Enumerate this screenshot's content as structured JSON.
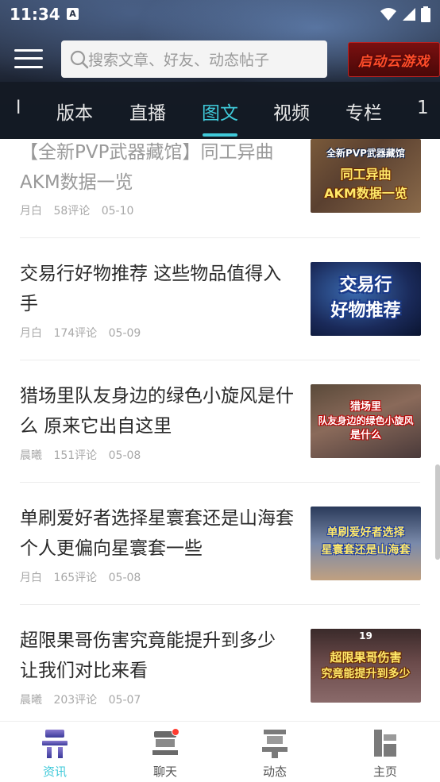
{
  "status_bar": {
    "time": "11:34",
    "a_icon": "A"
  },
  "header": {
    "search_placeholder": "搜索文章、好友、动态帖子",
    "cloud_game_button": "启动云游戏"
  },
  "tabs": [
    {
      "label": "l"
    },
    {
      "label": "版本"
    },
    {
      "label": "直播"
    },
    {
      "label": "图文",
      "active": true
    },
    {
      "label": "视频"
    },
    {
      "label": "专栏"
    },
    {
      "label": "1"
    }
  ],
  "articles": [
    {
      "title": "【全新PVP武器藏馆】同工异曲AKM数据一览",
      "author": "月白",
      "comments": "58评论",
      "date": "05-10",
      "thumb_lines": [
        "全新PVP武器藏馆",
        "同工异曲",
        "AKM数据一览"
      ]
    },
    {
      "title": "交易行好物推荐 这些物品值得入手",
      "author": "月白",
      "comments": "174评论",
      "date": "05-09",
      "thumb_lines": [
        "交易行",
        "好物推荐"
      ]
    },
    {
      "title": "猎场里队友身边的绿色小旋风是什么 原来它出自这里",
      "author": "晨曦",
      "comments": "151评论",
      "date": "05-08",
      "thumb_lines": [
        "猎场里",
        "队友身边的绿色小旋风",
        "是什么"
      ]
    },
    {
      "title": "单刷爱好者选择星寰套还是山海套 个人更偏向星寰套一些",
      "author": "月白",
      "comments": "165评论",
      "date": "05-08",
      "thumb_lines": [
        "单刷爱好者选择",
        "星寰套还是山海套"
      ]
    },
    {
      "title": "超限果哥伤害究竟能提升到多少 让我们对比来看",
      "author": "晨曦",
      "comments": "203评论",
      "date": "05-07",
      "thumb_lines": [
        "19",
        "超限果哥伤害",
        "究竟能提升到多少"
      ]
    }
  ],
  "bottom_nav": [
    {
      "label": "资讯",
      "icon": "news-glyph-icon",
      "active": true
    },
    {
      "label": "聊天",
      "icon": "chat-glyph-icon",
      "badge": true
    },
    {
      "label": "动态",
      "icon": "feed-glyph-icon"
    },
    {
      "label": "主页",
      "icon": "home-glyph-icon"
    }
  ],
  "colors": {
    "accent": "#3fc9d9",
    "badge": "#ff3b30",
    "header_bg": "#141a24"
  }
}
